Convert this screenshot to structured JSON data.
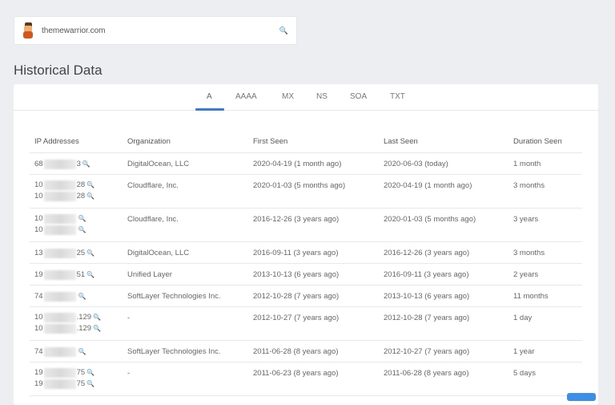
{
  "search": {
    "value": "themewarrior.com",
    "icon": "search-icon"
  },
  "title": "Historical Data",
  "tabs": [
    {
      "label": "A",
      "active": true
    },
    {
      "label": "AAAA"
    },
    {
      "label": "MX"
    },
    {
      "label": "NS"
    },
    {
      "label": "SOA"
    },
    {
      "label": "TXT"
    }
  ],
  "table": {
    "headers": [
      "IP Addresses",
      "Organization",
      "First Seen",
      "Last Seen",
      "Duration Seen"
    ],
    "rows": [
      {
        "ips": [
          {
            "pre": "68",
            "suf": "3"
          }
        ],
        "org": "DigitalOcean, LLC",
        "first": "2020-04-19 (1 month ago)",
        "last": "2020-06-03 (today)",
        "dur": "1 month"
      },
      {
        "ips": [
          {
            "pre": "10",
            "suf": "28"
          },
          {
            "pre": "10",
            "suf": "28"
          }
        ],
        "org": "Cloudflare, Inc.",
        "first": "2020-01-03 (5 months ago)",
        "last": "2020-04-19 (1 month ago)",
        "dur": "3 months"
      },
      {
        "ips": [
          {
            "pre": "10",
            "suf": ""
          },
          {
            "pre": "10",
            "suf": ""
          }
        ],
        "org": "Cloudflare, Inc.",
        "first": "2016-12-26 (3 years ago)",
        "last": "2020-01-03 (5 months ago)",
        "dur": "3 years"
      },
      {
        "ips": [
          {
            "pre": "13",
            "suf": "25"
          }
        ],
        "org": "DigitalOcean, LLC",
        "first": "2016-09-11 (3 years ago)",
        "last": "2016-12-26 (3 years ago)",
        "dur": "3 months"
      },
      {
        "ips": [
          {
            "pre": "19",
            "suf": "51"
          }
        ],
        "org": "Unified Layer",
        "first": "2013-10-13 (6 years ago)",
        "last": "2016-09-11 (3 years ago)",
        "dur": "2 years"
      },
      {
        "ips": [
          {
            "pre": "74",
            "suf": ""
          }
        ],
        "org": "SoftLayer Technologies Inc.",
        "first": "2012-10-28 (7 years ago)",
        "last": "2013-10-13 (6 years ago)",
        "dur": "11 months"
      },
      {
        "ips": [
          {
            "pre": "10",
            "suf": ".129"
          },
          {
            "pre": "10",
            "suf": ".129"
          }
        ],
        "org": "-",
        "first": "2012-10-27 (7 years ago)",
        "last": "2012-10-28 (7 years ago)",
        "dur": "1 day"
      },
      {
        "ips": [
          {
            "pre": "74",
            "suf": ""
          }
        ],
        "org": "SoftLayer Technologies Inc.",
        "first": "2011-06-28 (8 years ago)",
        "last": "2012-10-27 (7 years ago)",
        "dur": "1 year"
      },
      {
        "ips": [
          {
            "pre": "19",
            "suf": "75"
          },
          {
            "pre": "19",
            "suf": "75"
          }
        ],
        "org": "-",
        "first": "2011-06-23 (8 years ago)",
        "last": "2011-06-28 (8 years ago)",
        "dur": "5 days"
      }
    ]
  },
  "colors": {
    "accent": "#3a7bd5",
    "link_icon": "#3a55b0"
  }
}
